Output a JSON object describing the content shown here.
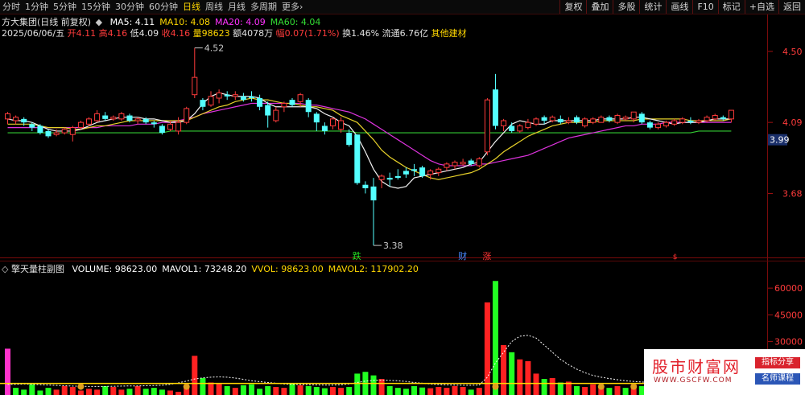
{
  "toolbar": {
    "periods": [
      "分时",
      "1分钟",
      "5分钟",
      "15分钟",
      "30分钟",
      "60分钟",
      "日线",
      "周线",
      "月线",
      "多周期",
      "更多"
    ],
    "active_period": "日线",
    "more_arrow": "›",
    "buttons": [
      "复权",
      "叠加",
      "多股",
      "统计",
      "画线",
      "F10",
      "标记",
      "+自选",
      "返回"
    ]
  },
  "info": {
    "stock_name": "方大集团(日线 前复权)",
    "ma_legend": [
      {
        "label": "MA5: 4.11",
        "color": "#ffffff"
      },
      {
        "label": "MA10: 4.08",
        "color": "#ffd700"
      },
      {
        "label": "MA20: 4.09",
        "color": "#ff33ff"
      },
      {
        "label": "MA60: 4.04",
        "color": "#33dd33"
      }
    ],
    "date": "2025/06/06/五",
    "open_label": "开",
    "open": "4.11",
    "high_label": "高",
    "high": "4.16",
    "low_label": "低",
    "low": "4.09",
    "close_label": "收",
    "close": "4.16",
    "volume_label": "量",
    "volume": "98623",
    "amount_label": "额",
    "amount": "4078万",
    "change_label": "幅",
    "change": "0.07(1.71%)",
    "turnover": "换1.46%",
    "float_cap": "流通6.76亿",
    "sector": "其他建材"
  },
  "vol_panel": {
    "title": "擎天量柱副图",
    "items": [
      {
        "label": "VOLUME: 98623.00",
        "color": "#ffffff"
      },
      {
        "label": "MAVOL1: 73248.20",
        "color": "#ffffff"
      },
      {
        "label": "VVOL: 98623.00",
        "color": "#ffd700"
      },
      {
        "label": "MAVOL2: 117902.20",
        "color": "#ffd700"
      }
    ]
  },
  "markers": [
    {
      "text": "跌",
      "color": "#22dd22"
    },
    {
      "text": "财",
      "color": "#4488ff"
    },
    {
      "text": "涨",
      "color": "#ff3333"
    }
  ],
  "watermark": {
    "logo": "股市财富网",
    "url": "WWW.GSCFW.COM",
    "tag1": "指标分享",
    "tag2": "名师课程"
  },
  "chart_data": {
    "type": "candlestick",
    "price_axis_ticks": [
      4.5,
      4.09,
      3.68
    ],
    "current_price_tag": "3.99",
    "annotations": [
      {
        "label": "4.52",
        "value": 4.52
      },
      {
        "label": "3.38",
        "value": 3.38
      }
    ],
    "candles": [
      [
        4.11,
        4.14,
        4.15,
        4.08
      ],
      [
        4.1,
        4.12,
        4.13,
        4.08
      ],
      [
        4.11,
        4.09,
        4.12,
        4.07
      ],
      [
        4.08,
        4.06,
        4.09,
        4.04
      ],
      [
        4.07,
        4.03,
        4.08,
        4.02
      ],
      [
        4.04,
        4.01,
        4.05,
        4.0
      ],
      [
        4.02,
        4.03,
        4.05,
        4.01
      ],
      [
        4.03,
        4.05,
        4.06,
        4.02
      ],
      [
        4.02,
        4.06,
        4.07,
        3.98
      ],
      [
        4.06,
        4.09,
        4.1,
        4.05
      ],
      [
        4.08,
        4.11,
        4.12,
        4.07
      ],
      [
        4.1,
        4.14,
        4.16,
        4.09
      ],
      [
        4.13,
        4.11,
        4.15,
        4.1
      ],
      [
        4.11,
        4.12,
        4.13,
        4.1
      ],
      [
        4.11,
        4.14,
        4.15,
        4.1
      ],
      [
        4.13,
        4.1,
        4.14,
        4.09
      ],
      [
        4.1,
        4.11,
        4.12,
        4.08
      ],
      [
        4.11,
        4.09,
        4.12,
        4.08
      ],
      [
        4.09,
        4.08,
        4.1,
        4.06
      ],
      [
        4.07,
        4.03,
        4.08,
        4.02
      ],
      [
        4.05,
        4.08,
        4.1,
        4.04
      ],
      [
        4.04,
        4.09,
        4.12,
        4.02
      ],
      [
        4.09,
        4.17,
        4.18,
        4.08
      ],
      [
        4.25,
        4.35,
        4.52,
        4.23
      ],
      [
        4.22,
        4.18,
        4.23,
        4.16
      ],
      [
        4.19,
        4.24,
        4.27,
        4.18
      ],
      [
        4.23,
        4.26,
        4.28,
        4.2
      ],
      [
        4.25,
        4.24,
        4.27,
        4.22
      ],
      [
        4.24,
        4.25,
        4.27,
        4.22
      ],
      [
        4.24,
        4.22,
        4.26,
        4.21
      ],
      [
        4.24,
        4.23,
        4.27,
        4.21
      ],
      [
        4.23,
        4.18,
        4.25,
        4.16
      ],
      [
        4.19,
        4.13,
        4.21,
        4.06
      ],
      [
        4.1,
        4.16,
        4.18,
        4.09
      ],
      [
        4.18,
        4.2,
        4.21,
        4.15
      ],
      [
        4.22,
        4.19,
        4.23,
        4.18
      ],
      [
        4.21,
        4.25,
        4.26,
        4.18
      ],
      [
        4.22,
        4.15,
        4.23,
        4.12
      ],
      [
        4.14,
        4.09,
        4.15,
        4.04
      ],
      [
        4.07,
        4.04,
        4.09,
        4.02
      ],
      [
        4.07,
        4.11,
        4.12,
        4.05
      ],
      [
        4.05,
        4.1,
        4.12,
        4.03
      ],
      [
        4.03,
        3.96,
        4.05,
        3.95
      ],
      [
        4.02,
        3.74,
        4.02,
        3.73
      ],
      [
        3.73,
        3.71,
        3.75,
        3.68
      ],
      [
        3.72,
        3.64,
        3.77,
        3.38
      ],
      [
        3.76,
        3.78,
        3.79,
        3.71
      ],
      [
        3.77,
        3.76,
        3.8,
        3.72
      ],
      [
        3.78,
        3.77,
        3.82,
        3.76
      ],
      [
        3.81,
        3.79,
        3.83,
        3.77
      ],
      [
        3.82,
        3.81,
        3.85,
        3.78
      ],
      [
        3.83,
        3.78,
        3.84,
        3.77
      ],
      [
        3.79,
        3.81,
        3.82,
        3.76
      ],
      [
        3.8,
        3.82,
        3.83,
        3.78
      ],
      [
        3.83,
        3.85,
        3.86,
        3.81
      ],
      [
        3.84,
        3.86,
        3.87,
        3.82
      ],
      [
        3.85,
        3.86,
        3.88,
        3.84
      ],
      [
        3.87,
        3.85,
        3.88,
        3.84
      ],
      [
        3.84,
        3.88,
        3.89,
        3.83
      ],
      [
        3.92,
        4.22,
        4.23,
        3.9
      ],
      [
        4.28,
        4.07,
        4.37,
        4.05
      ],
      [
        4.07,
        4.1,
        4.11,
        4.04
      ],
      [
        4.07,
        4.04,
        4.09,
        4.03
      ],
      [
        4.04,
        4.07,
        4.08,
        4.03
      ],
      [
        4.06,
        4.09,
        4.11,
        4.05
      ],
      [
        4.08,
        4.11,
        4.12,
        4.07
      ],
      [
        4.12,
        4.1,
        4.13,
        4.08
      ],
      [
        4.1,
        4.12,
        4.13,
        4.09
      ],
      [
        4.11,
        4.09,
        4.13,
        4.08
      ],
      [
        4.09,
        4.1,
        4.12,
        4.08
      ],
      [
        4.12,
        4.09,
        4.13,
        4.08
      ],
      [
        4.07,
        4.11,
        4.12,
        4.06
      ],
      [
        4.09,
        4.11,
        4.12,
        4.08
      ],
      [
        4.09,
        4.12,
        4.13,
        4.09
      ],
      [
        4.12,
        4.1,
        4.13,
        4.09
      ],
      [
        4.09,
        4.13,
        4.14,
        4.08
      ],
      [
        4.11,
        4.12,
        4.13,
        4.1
      ],
      [
        4.11,
        4.15,
        4.15,
        4.09
      ],
      [
        4.14,
        4.09,
        4.15,
        4.08
      ],
      [
        4.09,
        4.06,
        4.1,
        4.05
      ],
      [
        4.06,
        4.08,
        4.09,
        4.05
      ],
      [
        4.07,
        4.09,
        4.1,
        4.06
      ],
      [
        4.08,
        4.1,
        4.11,
        4.07
      ],
      [
        4.09,
        4.11,
        4.12,
        4.08
      ],
      [
        4.1,
        4.09,
        4.12,
        4.08
      ],
      [
        4.09,
        4.1,
        4.11,
        4.08
      ],
      [
        4.1,
        4.12,
        4.13,
        4.09
      ],
      [
        4.11,
        4.13,
        4.14,
        4.1
      ],
      [
        4.12,
        4.11,
        4.13,
        4.1
      ],
      [
        4.11,
        4.16,
        4.16,
        4.09
      ]
    ],
    "ma5": [
      4.11,
      4.1,
      4.1,
      4.09,
      4.07,
      4.05,
      4.04,
      4.04,
      4.04,
      4.05,
      4.07,
      4.09,
      4.1,
      4.11,
      4.12,
      4.12,
      4.12,
      4.11,
      4.11,
      4.1,
      4.09,
      4.09,
      4.1,
      4.14,
      4.2,
      4.24,
      4.26,
      4.25,
      4.24,
      4.24,
      4.24,
      4.23,
      4.2,
      4.18,
      4.18,
      4.18,
      4.18,
      4.18,
      4.17,
      4.14,
      4.12,
      4.09,
      4.07,
      4.01,
      3.92,
      3.82,
      3.75,
      3.72,
      3.71,
      3.72,
      3.77,
      3.78,
      3.79,
      3.8,
      3.81,
      3.82,
      3.83,
      3.85,
      3.86,
      3.92,
      3.98,
      4.03,
      4.08,
      4.1,
      4.09,
      4.08,
      4.08,
      4.1,
      4.1,
      4.1,
      4.1,
      4.1,
      4.1,
      4.11,
      4.11,
      4.11,
      4.11,
      4.12,
      4.12,
      4.11,
      4.1,
      4.09,
      4.08,
      4.09,
      4.09,
      4.09,
      4.1,
      4.11,
      4.11,
      4.11
    ],
    "ma10": [
      4.08,
      4.08,
      4.08,
      4.08,
      4.07,
      4.06,
      4.06,
      4.06,
      4.05,
      4.05,
      4.06,
      4.07,
      4.07,
      4.08,
      4.09,
      4.1,
      4.1,
      4.1,
      4.1,
      4.1,
      4.1,
      4.1,
      4.1,
      4.12,
      4.14,
      4.16,
      4.18,
      4.19,
      4.21,
      4.22,
      4.23,
      4.22,
      4.22,
      4.21,
      4.2,
      4.2,
      4.19,
      4.18,
      4.18,
      4.17,
      4.16,
      4.13,
      4.11,
      4.09,
      4.04,
      3.99,
      3.93,
      3.89,
      3.86,
      3.83,
      3.81,
      3.79,
      3.77,
      3.76,
      3.77,
      3.78,
      3.79,
      3.8,
      3.82,
      3.85,
      3.88,
      3.92,
      3.95,
      3.98,
      4.01,
      4.03,
      4.05,
      4.07,
      4.08,
      4.09,
      4.09,
      4.09,
      4.09,
      4.1,
      4.1,
      4.1,
      4.1,
      4.1,
      4.11,
      4.11,
      4.11,
      4.11,
      4.11,
      4.11,
      4.1,
      4.1,
      4.1,
      4.1,
      4.1,
      4.11
    ],
    "ma20": [
      4.06,
      4.06,
      4.06,
      4.06,
      4.06,
      4.06,
      4.06,
      4.06,
      4.06,
      4.06,
      4.06,
      4.06,
      4.07,
      4.07,
      4.07,
      4.07,
      4.08,
      4.08,
      4.08,
      4.09,
      4.09,
      4.1,
      4.11,
      4.12,
      4.14,
      4.15,
      4.16,
      4.17,
      4.18,
      4.19,
      4.2,
      4.2,
      4.2,
      4.2,
      4.2,
      4.2,
      4.2,
      4.19,
      4.19,
      4.18,
      4.17,
      4.16,
      4.15,
      4.13,
      4.11,
      4.08,
      4.05,
      4.02,
      3.99,
      3.96,
      3.93,
      3.9,
      3.87,
      3.85,
      3.84,
      3.84,
      3.84,
      3.84,
      3.85,
      3.85,
      3.86,
      3.87,
      3.88,
      3.89,
      3.9,
      3.92,
      3.94,
      3.96,
      3.98,
      4.0,
      4.01,
      4.02,
      4.03,
      4.04,
      4.05,
      4.06,
      4.07,
      4.07,
      4.08,
      4.08,
      4.08,
      4.09,
      4.09,
      4.09,
      4.09,
      4.09,
      4.09,
      4.09,
      4.09,
      4.09
    ],
    "ma60": [
      4.03,
      4.03,
      4.03,
      4.03,
      4.03,
      4.03,
      4.03,
      4.03,
      4.03,
      4.03,
      4.03,
      4.03,
      4.03,
      4.03,
      4.03,
      4.03,
      4.03,
      4.03,
      4.03,
      4.03,
      4.04,
      4.04,
      4.04,
      4.04,
      4.04,
      4.04,
      4.04,
      4.04,
      4.04,
      4.04,
      4.04,
      4.04,
      4.04,
      4.04,
      4.04,
      4.04,
      4.04,
      4.04,
      4.04,
      4.04,
      4.04,
      4.04,
      4.04,
      4.03,
      4.03,
      4.03,
      4.03,
      4.03,
      4.03,
      4.03,
      4.03,
      4.03,
      4.03,
      4.03,
      4.03,
      4.03,
      4.03,
      4.03,
      4.03,
      4.03,
      4.03,
      4.03,
      4.03,
      4.03,
      4.03,
      4.03,
      4.03,
      4.03,
      4.03,
      4.03,
      4.03,
      4.03,
      4.03,
      4.03,
      4.03,
      4.03,
      4.03,
      4.03,
      4.03,
      4.03,
      4.03,
      4.03,
      4.03,
      4.03,
      4.03,
      4.04,
      4.04,
      4.04,
      4.04,
      4.04
    ],
    "volume_axis_ticks": [
      60000,
      45000,
      30000
    ],
    "volumes": [
      26000,
      4000,
      3000,
      6000,
      2500,
      4000,
      3000,
      5000,
      4500,
      2500,
      3500,
      3000,
      5000,
      4500,
      3000,
      3500,
      5000,
      3500,
      4000,
      3000,
      2500,
      1800,
      4000,
      22000,
      9500,
      7000,
      6500,
      5000,
      4000,
      5500,
      6000,
      3500,
      5000,
      4500,
      4000,
      6500,
      5500,
      5000,
      4500,
      3800,
      4500,
      4000,
      4500,
      12000,
      13000,
      11000,
      9000,
      5000,
      4000,
      3500,
      5000,
      4200,
      3800,
      4500,
      4000,
      5000,
      4500,
      3000,
      4000,
      52000,
      64000,
      28000,
      24000,
      20000,
      19000,
      12000,
      9000,
      9500,
      7000,
      7500,
      5000,
      4500,
      6000,
      4500,
      4000,
      5000,
      4000,
      6000,
      5000,
      8000,
      4500,
      5500,
      6000,
      4000,
      5000,
      5500,
      4500,
      4000,
      5000,
      9862
    ],
    "vol_up": [
      1,
      0,
      0,
      0,
      0,
      0,
      1,
      1,
      1,
      1,
      1,
      1,
      0,
      1,
      1,
      0,
      1,
      0,
      0,
      0,
      1,
      1,
      1,
      1,
      0,
      1,
      1,
      0,
      1,
      0,
      0,
      0,
      0,
      1,
      1,
      0,
      1,
      0,
      0,
      0,
      1,
      1,
      0,
      0,
      0,
      0,
      1,
      0,
      0,
      0,
      0,
      0,
      1,
      1,
      1,
      1,
      1,
      0,
      1,
      1,
      0,
      1,
      0,
      1,
      1,
      1,
      0,
      1,
      0,
      1,
      0,
      1,
      1,
      1,
      0,
      1,
      0,
      1,
      0,
      0,
      1,
      1,
      1,
      1,
      0,
      1,
      1,
      1,
      0,
      1
    ],
    "vvol_line": [
      6000,
      6000,
      6200,
      6000,
      5800,
      5600,
      5400,
      5200,
      5000,
      4900,
      4800,
      4800,
      4800,
      4900,
      5000,
      5100,
      5100,
      5200,
      5300,
      5500,
      6000,
      6800,
      7800,
      9000,
      9600,
      10000,
      10200,
      10000,
      9500,
      8800,
      8000,
      7500,
      7000,
      6600,
      6200,
      6000,
      5900,
      5800,
      5700,
      5600,
      5600,
      5800,
      6200,
      7000,
      7800,
      8200,
      8300,
      8200,
      8000,
      7600,
      7000,
      6600,
      6200,
      5900,
      5700,
      5600,
      5500,
      5500,
      5600,
      10000,
      18000,
      24000,
      30000,
      33000,
      33500,
      32000,
      28000,
      24000,
      20000,
      17000,
      14500,
      12500,
      11000,
      10000,
      9200,
      8600,
      8000,
      7600,
      7300,
      7000,
      6800,
      6600,
      6500,
      6400,
      6300,
      6200,
      6200,
      6300,
      6400,
      6500
    ],
    "mavol2_line": 6500
  }
}
